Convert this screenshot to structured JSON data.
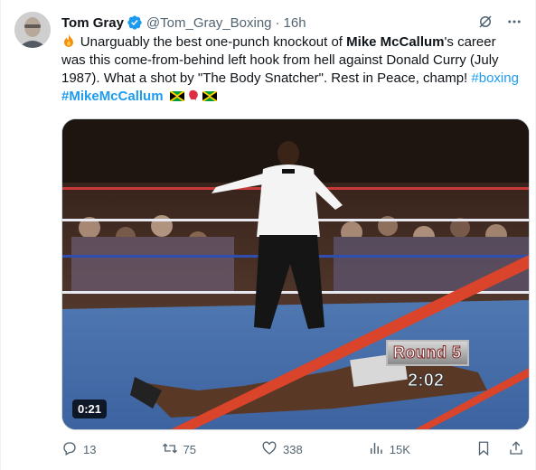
{
  "author": {
    "name": "Tom Gray",
    "handle": "@Tom_Gray_Boxing",
    "separator": "·",
    "time": "16h"
  },
  "tweet": {
    "seg1": " Unarguably the best one-punch knockout of ",
    "seg2_bold": "Mike McCallum",
    "seg3": "'s career was this come-from-behind left hook from hell against Donald Curry (July 1987). What a shot by \"The Body Snatcher\". Rest in Peace, champ! ",
    "hashtag1": "#boxing",
    "hashtag2": "#MikeMcCallum"
  },
  "media": {
    "duration": "0:21",
    "overlay_round": "Round 5",
    "overlay_clock": "2:02"
  },
  "actions": {
    "replies": "13",
    "reposts": "75",
    "likes": "338",
    "views": "15K"
  },
  "icons": {
    "verified": "verified-badge-icon",
    "grok": "grok-icon",
    "more": "more-icon",
    "reply": "reply-icon",
    "repost": "repost-icon",
    "like": "like-icon",
    "views": "views-icon",
    "bookmark": "bookmark-icon",
    "share": "share-icon"
  },
  "colors": {
    "accent": "#1d9bf0",
    "secondary_text": "#536471",
    "primary_text": "#0f1419"
  }
}
